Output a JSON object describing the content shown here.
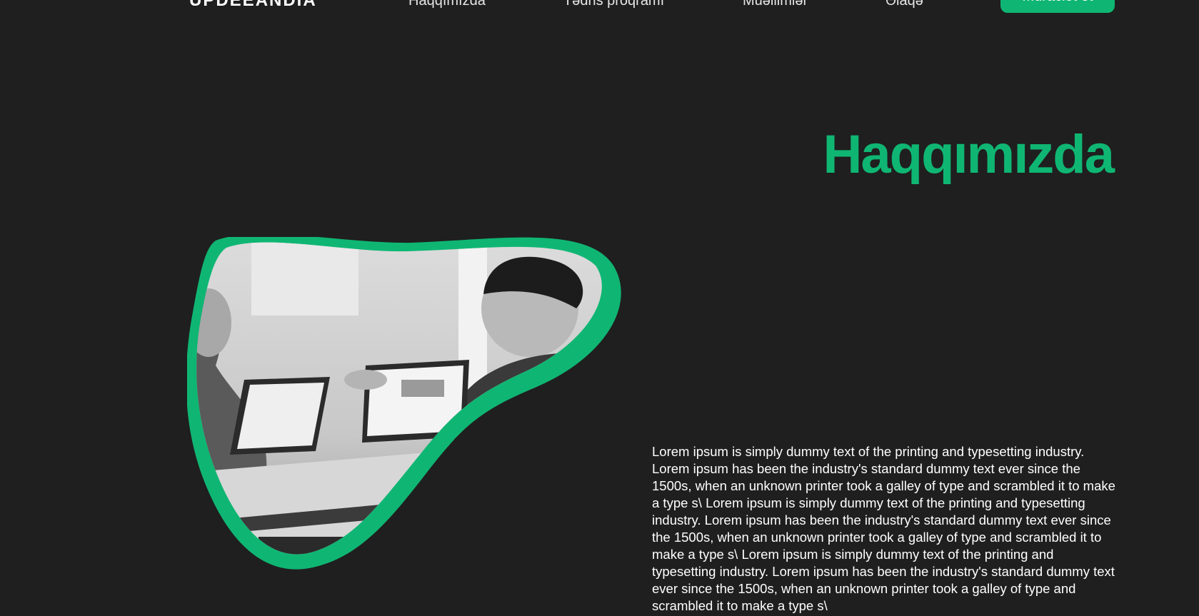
{
  "nav": {
    "logo": "UPDEEANDIA",
    "links": [
      "Haqqımızda",
      "Tədris proqramı",
      "Müəllimlər",
      "Əlaqə"
    ],
    "cta_label": "Müraciət et"
  },
  "about": {
    "title": "Haqqımızda",
    "body": "Lorem ipsum is simply dummy text of the printing and typesetting industry. Lorem ipsum has been the industry's standard dummy text ever since the 1500s, when an unknown printer took a galley of type and scrambled it to make a type s\\ Lorem ipsum is simply dummy text of the printing and typesetting industry. Lorem ipsum has been the industry's standard dummy text ever since the 1500s, when an unknown printer took a galley of type and scrambled it to make a type s\\ Lorem ipsum is simply dummy text of the printing and typesetting industry. Lorem ipsum has been the industry's standard dummy text ever since the 1500s, when an unknown printer took a galley of type and scrambled it to make a type s\\"
  },
  "colors": {
    "background": "#1f1f1f",
    "accent": "#0fb673",
    "text": "#ffffff"
  }
}
